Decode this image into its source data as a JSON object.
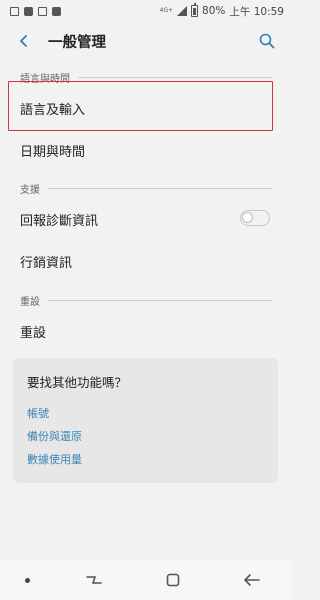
{
  "status_bar": {
    "network": "4G+",
    "battery_percent": "80%",
    "time": "上午 10:59"
  },
  "header": {
    "title": "一般管理"
  },
  "sections": {
    "language_time": {
      "header": "語言與時間",
      "items": [
        "語言及輸入",
        "日期與時間"
      ]
    },
    "support": {
      "header": "支援",
      "items": [
        "回報診斷資訊",
        "行銷資訊"
      ]
    },
    "reset": {
      "header": "重設",
      "items": [
        "重設"
      ]
    }
  },
  "toggle": {
    "state": "off"
  },
  "card": {
    "title": "要找其他功能嗎？",
    "links": [
      "帳號",
      "備份與還原",
      "數據使用量"
    ]
  },
  "colors": {
    "highlight": "#d0343d",
    "link": "#3d84b5",
    "accent": "#2f7fb6"
  },
  "icons": {
    "back": "back-arrow-icon",
    "search": "search-icon",
    "recents": "recents-icon",
    "home": "home-icon",
    "back_nav": "back-nav-icon"
  }
}
